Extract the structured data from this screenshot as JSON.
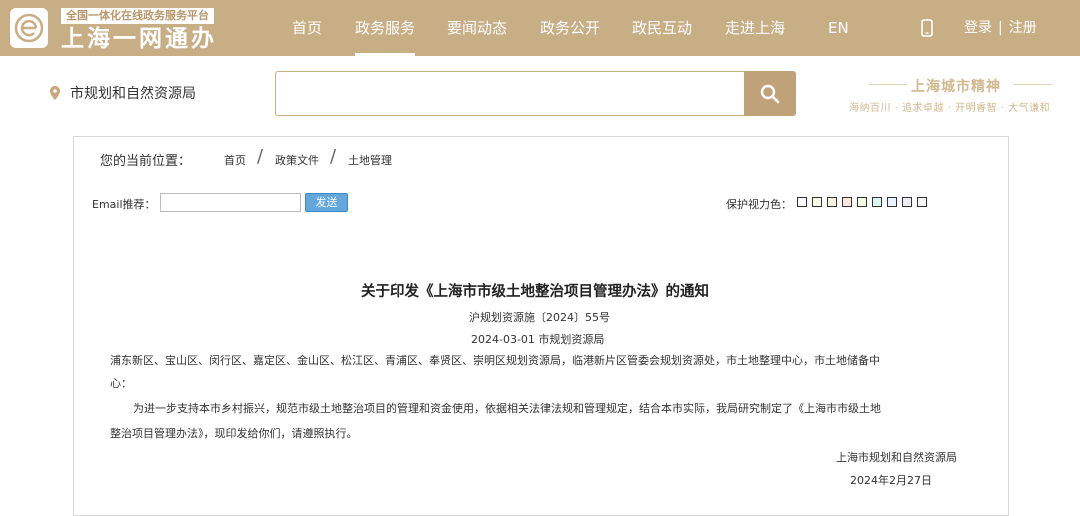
{
  "header": {
    "logo_tagline": "全国一体化在线政务服务平台",
    "logo_title": "上海一网通办",
    "nav": [
      {
        "label": "首页"
      },
      {
        "label": "政务服务"
      },
      {
        "label": "要闻动态"
      },
      {
        "label": "政务公开"
      },
      {
        "label": "政民互动"
      },
      {
        "label": "走进上海"
      },
      {
        "label": "EN"
      }
    ],
    "active_nav_index": 1,
    "login_label": "登录",
    "register_label": "注册",
    "login_separator": "|",
    "bar_color": "#c8ae85"
  },
  "search": {
    "location": "市规划和自然资源局",
    "placeholder": "",
    "spirit_title": "上海城市精神",
    "spirit_motto": "海纳百川 · 追求卓越 · 开明睿智 · 大气谦和"
  },
  "breadcrumb": {
    "label": "您的当前位置：",
    "items": [
      "首页",
      "政策文件",
      "土地管理"
    ],
    "separator": "/"
  },
  "tools": {
    "email_label": "Email推荐：",
    "email_value": "",
    "send_label": "发送",
    "eye_care_label": "保护视力色：",
    "swatch_colors": [
      "#ffffff",
      "#fafbe6",
      "#fff2e2",
      "#fde6e0",
      "#f3ffe1",
      "#dafaf2",
      "#e8f4ff",
      "#eeeef4",
      "#f5f5f5"
    ]
  },
  "document": {
    "title": "关于印发《上海市市级土地整治项目管理办法》的通知",
    "doc_number": "沪规划资源施〔2024〕55号",
    "meta": "2024-03-01 市规划资源局",
    "recipients_line1": "浦东新区、宝山区、闵行区、嘉定区、金山区、松江区、青浦区、奉贤区、崇明区规划资源局，临港新片区管委会规划资源处，市土地整理中心，市土地储备中",
    "recipients_line2": "心：",
    "body_line1": "为进一步支持本市乡村振兴，规范市级土地整治项目的管理和资金使用，依据相关法律法规和管理规定，结合本市实际，我局研究制定了《上海市市级土地",
    "body_line2": "整治项目管理办法》，现印发给你们，请遵照执行。",
    "signature": "上海市规划和自然资源局",
    "date": "2024年2月27日"
  }
}
